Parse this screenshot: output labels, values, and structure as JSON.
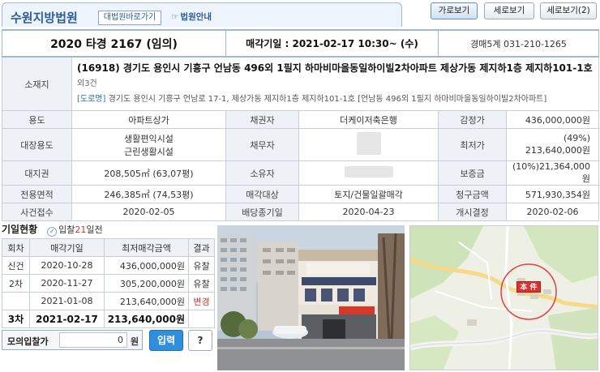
{
  "header": {
    "court_name": "수원지방법원",
    "court_link": "대법원바로가기",
    "court_info": "법원안내",
    "view_buttons": [
      "가로보기",
      "세로보기",
      "세로보기(2)"
    ]
  },
  "case": {
    "case_no": "2020 타경 2167 (임의)",
    "sale_date_label": "매각기일",
    "sale_date": "2021-02-17 10:30~ (수)",
    "contact": "경매5계 031-210-1265"
  },
  "address": {
    "label": "소재지",
    "main": "(16918) 경기도 용인시 기흥구 언남동 496외 1필지 하마비마을동일하이빌2차아파트 제상가동 제지하1층 제지하101-1호",
    "etc": "외3건",
    "road_tag": "[도로명]",
    "road": "경기도 용인시 기흥구 언남로 17-1, 제상가동 제지하1층 제지하101-1호 [언남동 496외 1필지 하마비마을동일하이빌2차아파트]"
  },
  "details": {
    "usage_label": "용도",
    "usage": "아파트상가",
    "creditor_label": "채권자",
    "creditor": "더케이저축은행",
    "appraisal_label": "감정가",
    "appraisal": "436,000,000원",
    "main_usage_label": "대장용도",
    "main_usage_1": "생활편익시설",
    "main_usage_2": "근린생활시설",
    "debtor_label": "채무자",
    "min_price_label": "최저가",
    "min_price": "(49%) 213,640,000원",
    "land_label": "대지권",
    "land": "208,505㎡ (63,07평)",
    "owner_label": "소유자",
    "deposit_label": "보증금",
    "deposit": "(10%)21,364,000원",
    "area_label": "전용면적",
    "area": "246,385㎡ (74,53평)",
    "sale_target_label": "매각대상",
    "sale_target": "토지/건물일괄매각",
    "claim_label": "청구금액",
    "claim": "571,930,354원",
    "receipt_label": "사건접수",
    "receipt": "2020-02-05",
    "dividend_label": "배당종기일",
    "dividend": "2020-04-23",
    "start_label": "개시결정",
    "start": "2020-02-06"
  },
  "history": {
    "title": "기일현황",
    "bid_prefix": "입찰",
    "bid_days": "21",
    "bid_suffix": "일전",
    "headers": [
      "회차",
      "매각기일",
      "최저매각금액",
      "결과"
    ],
    "rows": [
      {
        "round": "신건",
        "date": "2020-10-28",
        "amount": "436,000,000원",
        "result": "유찰"
      },
      {
        "round": "2차",
        "date": "2020-11-27",
        "amount": "305,200,000원",
        "result": "유찰"
      },
      {
        "round": "",
        "date": "2021-01-08",
        "amount": "213,640,000원",
        "result": "변경"
      },
      {
        "round": "3차",
        "date": "2021-02-17",
        "amount": "213,640,000원",
        "result": ""
      }
    ]
  },
  "mock_bid": {
    "label": "모의입찰가",
    "value": "0",
    "unit": "원",
    "submit": "입력",
    "help": "?"
  },
  "map": {
    "marker": "本 件"
  },
  "colors": {
    "accent": "#2d5d9a",
    "red": "#d0362c",
    "button": "#2f8fdc"
  }
}
